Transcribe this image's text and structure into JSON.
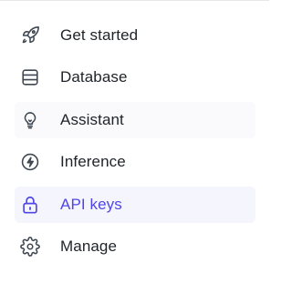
{
  "colors": {
    "text": "#1f2328",
    "icon": "#3f4752",
    "active": "#4f46e5",
    "active_background": "#f5f5fe",
    "hover_background": "#fafafc",
    "top_border": "#e5e7eb"
  },
  "nav": {
    "items": [
      {
        "label": "Get started",
        "icon": "rocket-icon",
        "state": "default"
      },
      {
        "label": "Database",
        "icon": "database-icon",
        "state": "default"
      },
      {
        "label": "Assistant",
        "icon": "lightbulb-icon",
        "state": "hover"
      },
      {
        "label": "Inference",
        "icon": "bolt-icon",
        "state": "default"
      },
      {
        "label": "API keys",
        "icon": "lock-icon",
        "state": "active"
      },
      {
        "label": "Manage",
        "icon": "gear-icon",
        "state": "default"
      }
    ]
  }
}
